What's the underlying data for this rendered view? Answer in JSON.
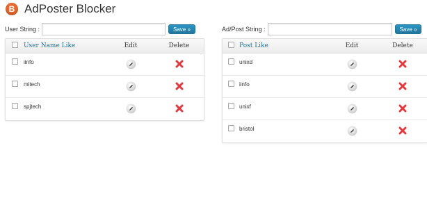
{
  "app": {
    "logo_letter": "B",
    "title": "AdPoster Blocker"
  },
  "user_form": {
    "label": "User String :",
    "value": "",
    "save_label": "Save »"
  },
  "post_form": {
    "label": "Ad/Post String :",
    "value": "",
    "save_label": "Save »"
  },
  "user_table": {
    "headers": {
      "name": "User Name Like",
      "edit": "Edit",
      "delete": "Delete"
    },
    "rows": [
      {
        "name": "iinfo"
      },
      {
        "name": "mitech"
      },
      {
        "name": "spjtech"
      }
    ]
  },
  "post_table": {
    "headers": {
      "name": "Post Like",
      "edit": "Edit",
      "delete": "Delete"
    },
    "rows": [
      {
        "name": "unixd"
      },
      {
        "name": "iinfo"
      },
      {
        "name": "unixf"
      },
      {
        "name": "bristol"
      }
    ]
  },
  "icons": {
    "logo": "b-logo-icon",
    "edit": "pencil-icon",
    "delete": "red-x-icon"
  },
  "colors": {
    "logo": "#e8682d",
    "button": "#21759b",
    "link": "#21759b",
    "delete": "#e0393e"
  }
}
